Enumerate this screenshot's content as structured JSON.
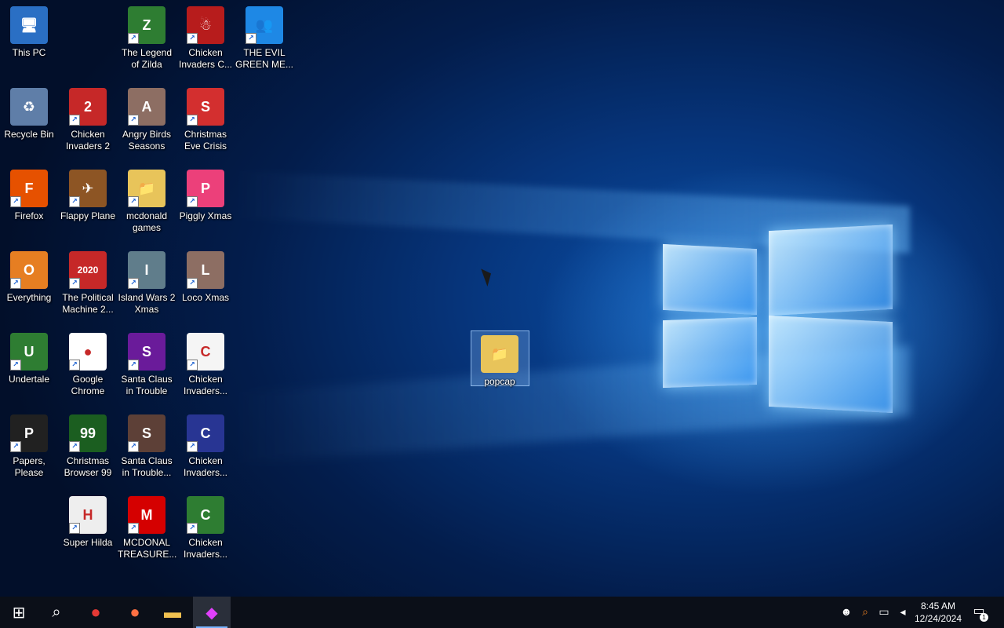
{
  "desktop_icons": [
    {
      "label": "This PC",
      "bg": "#2a6fc4",
      "glyph": "🖥"
    },
    {
      "label": "The Legend of Zilda",
      "bg": "#2e7d32",
      "glyph": "Z"
    },
    {
      "label": "Chicken Invaders C...",
      "bg": "#b71c1c",
      "glyph": "☃"
    },
    {
      "label": "THE EVIL GREEN ME...",
      "bg": "#1e88e5",
      "glyph": "👥"
    },
    {
      "label": "Recycle Bin",
      "bg": "#5f7ea8",
      "glyph": "♻"
    },
    {
      "label": "Chicken Invaders 2",
      "bg": "#c62828",
      "glyph": "2"
    },
    {
      "label": "Angry Birds Seasons",
      "bg": "#8d6e63",
      "glyph": "A"
    },
    {
      "label": "Christmas Eve Crisis",
      "bg": "#d32f2f",
      "glyph": "S"
    },
    {
      "label": "Firefox",
      "bg": "#e65100",
      "glyph": "F"
    },
    {
      "label": "Flappy Plane",
      "bg": "#8d5524",
      "glyph": "✈"
    },
    {
      "label": "mcdonald games",
      "bg": "#e8c45a",
      "glyph": "📁"
    },
    {
      "label": "Piggly Xmas",
      "bg": "#ec407a",
      "glyph": "P"
    },
    {
      "label": "Everything",
      "bg": "#e67e22",
      "glyph": "O"
    },
    {
      "label": "The Political Machine 2...",
      "bg": "#c62828",
      "glyph": "2020"
    },
    {
      "label": "Island Wars 2 Xmas",
      "bg": "#607d8b",
      "glyph": "I"
    },
    {
      "label": "Loco Xmas",
      "bg": "#8d6e63",
      "glyph": "L"
    },
    {
      "label": "Undertale",
      "bg": "#2e7d32",
      "glyph": "U"
    },
    {
      "label": "Google Chrome",
      "bg": "#ffffff",
      "glyph": "●"
    },
    {
      "label": "Santa Claus in Trouble",
      "bg": "#6a1b9a",
      "glyph": "S"
    },
    {
      "label": "Chicken Invaders...",
      "bg": "#f5f5f5",
      "glyph": "C"
    },
    {
      "label": "Papers, Please",
      "bg": "#212121",
      "glyph": "P"
    },
    {
      "label": "Christmas Browser 99",
      "bg": "#1b5e20",
      "glyph": "99"
    },
    {
      "label": "Santa Claus in Trouble...",
      "bg": "#5d4037",
      "glyph": "S"
    },
    {
      "label": "Chicken Invaders...",
      "bg": "#283593",
      "glyph": "C"
    },
    {
      "label": "Super Hilda",
      "bg": "#eeeeee",
      "glyph": "H"
    },
    {
      "label": "MCDONAL TREASURE...",
      "bg": "#d50000",
      "glyph": "M"
    },
    {
      "label": "Chicken Invaders...",
      "bg": "#2e7d32",
      "glyph": "C"
    }
  ],
  "selected_icon": {
    "label": "popcap",
    "bg": "#e8c45a",
    "glyph": "📁"
  },
  "taskbar": {
    "start_glyph": "⊞",
    "search_glyph": "⌕",
    "apps": [
      {
        "name": "chrome",
        "glyph": "●",
        "color": "#e53935"
      },
      {
        "name": "firefox",
        "glyph": "●",
        "color": "#ff7043"
      },
      {
        "name": "file-explorer",
        "glyph": "▬",
        "color": "#f0c050"
      },
      {
        "name": "running-app",
        "glyph": "◆",
        "color": "#e040fb"
      }
    ],
    "time": "8:45 AM",
    "date": "12/24/2024",
    "notification_count": "1"
  }
}
